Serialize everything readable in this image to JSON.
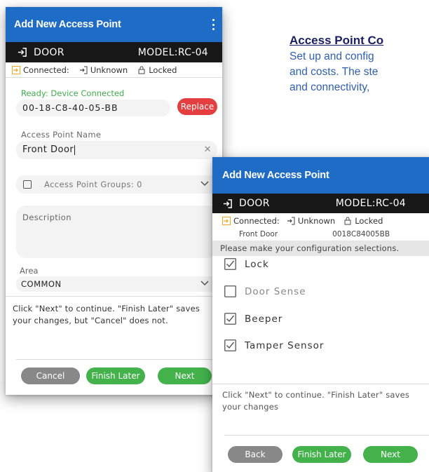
{
  "article": {
    "title": "Access Point Co",
    "lines": [
      "Set up and config",
      "and costs. The ste",
      "and connectivity,"
    ]
  },
  "panel_a": {
    "title": "Add New Access Point",
    "door_label": "DOOR",
    "model": "MODEL:RC-04",
    "status": {
      "connected": "Connected:",
      "unknown": "Unknown",
      "locked": "Locked"
    },
    "ready_text": "Ready: Device Connected",
    "mac_value": "00-18-C8-40-05-BB",
    "replace_label": "Replace",
    "name_label": "Access Point Name",
    "name_value": "Front Door",
    "groups_label": "Access Point Groups:  0",
    "description_placeholder": "Description",
    "area_label": "Area",
    "area_value": "COMMON",
    "hint": [
      "Click \"Next\" to continue. \"Finish Later\" saves",
      "your changes, but \"Cancel\" does not."
    ],
    "buttons": {
      "cancel": "Cancel",
      "finish_later": "Finish Later",
      "next": "Next"
    }
  },
  "panel_b": {
    "title": "Add New Access Point",
    "door_label": "DOOR",
    "model": "MODEL:RC-04",
    "status": {
      "connected": "Connected:",
      "unknown": "Unknown",
      "locked": "Locked"
    },
    "info": {
      "name": "Front Door",
      "mac": "0018C84005BB"
    },
    "prompt": "Please make your configuration selections.",
    "options": [
      {
        "label": "Lock",
        "checked": true
      },
      {
        "label": "Door Sense",
        "checked": false
      },
      {
        "label": "Beeper",
        "checked": true
      },
      {
        "label": "Tamper Sensor",
        "checked": true
      }
    ],
    "hint": [
      "Click \"Next\" to continue. \"Finish Later\" saves",
      "your changes"
    ],
    "buttons": {
      "back": "Back",
      "finish_later": "Finish Later",
      "next": "Next"
    }
  },
  "colors": {
    "titlebar": "#1f6cc7",
    "modelbar": "#171717",
    "green": "#43b24b",
    "red": "#e53e3e",
    "grey_button": "#888888",
    "ready_green": "#3fae49",
    "article_title": "#1a1f63",
    "article_body": "#2f5fb0",
    "connected_icon": "#f5a623"
  }
}
